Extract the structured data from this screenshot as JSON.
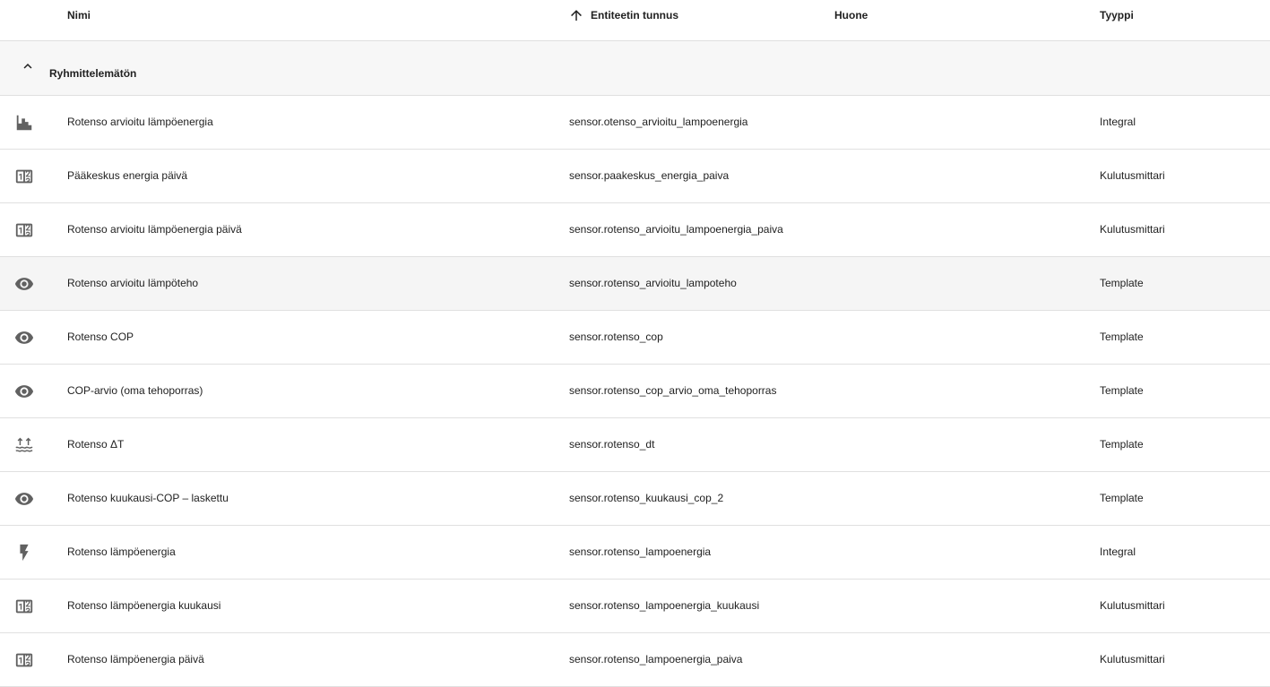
{
  "header": {
    "name": "Nimi",
    "entity_id": "Entiteetin tunnus",
    "area": "Huone",
    "type": "Tyyppi",
    "sort_icon": "arrow-up-icon"
  },
  "group": {
    "label": "Ryhmittelemätön",
    "icon": "chevron-up-icon"
  },
  "colors": {
    "icon": "#616161",
    "divider": "#e0e0e0",
    "group_bg": "#f7f7f7",
    "hover_bg": "#f5f5f5"
  },
  "rows": [
    {
      "icon": "chart-histogram-icon",
      "name": "Rotenso arvioitu lämpöenergia",
      "entity_id": "sensor.otenso_arvioitu_lampoenergia",
      "area": "",
      "type": "Integral"
    },
    {
      "icon": "counter-icon",
      "name": "Pääkeskus energia päivä",
      "entity_id": "sensor.paakeskus_energia_paiva",
      "area": "",
      "type": "Kulutusmittari"
    },
    {
      "icon": "counter-icon",
      "name": "Rotenso arvioitu lämpöenergia päivä",
      "entity_id": "sensor.rotenso_arvioitu_lampoenergia_paiva",
      "area": "",
      "type": "Kulutusmittari"
    },
    {
      "icon": "eye-icon",
      "name": "Rotenso arvioitu lämpöteho",
      "entity_id": "sensor.rotenso_arvioitu_lampoteho",
      "area": "",
      "type": "Template"
    },
    {
      "icon": "eye-icon",
      "name": "Rotenso COP",
      "entity_id": "sensor.rotenso_cop",
      "area": "",
      "type": "Template"
    },
    {
      "icon": "eye-icon",
      "name": "COP-arvio (oma tehoporras)",
      "entity_id": "sensor.rotenso_cop_arvio_oma_tehoporras",
      "area": "",
      "type": "Template"
    },
    {
      "icon": "heat-wave-icon",
      "name": "Rotenso ΔT",
      "entity_id": "sensor.rotenso_dt",
      "area": "",
      "type": "Template"
    },
    {
      "icon": "eye-icon",
      "name": "Rotenso kuukausi-COP – laskettu",
      "entity_id": "sensor.rotenso_kuukausi_cop_2",
      "area": "",
      "type": "Template"
    },
    {
      "icon": "flash-icon",
      "name": "Rotenso lämpöenergia",
      "entity_id": "sensor.rotenso_lampoenergia",
      "area": "",
      "type": "Integral"
    },
    {
      "icon": "counter-icon",
      "name": "Rotenso lämpöenergia kuukausi",
      "entity_id": "sensor.rotenso_lampoenergia_kuukausi",
      "area": "",
      "type": "Kulutusmittari"
    },
    {
      "icon": "counter-icon",
      "name": "Rotenso lämpöenergia päivä",
      "entity_id": "sensor.rotenso_lampoenergia_paiva",
      "area": "",
      "type": "Kulutusmittari"
    }
  ]
}
